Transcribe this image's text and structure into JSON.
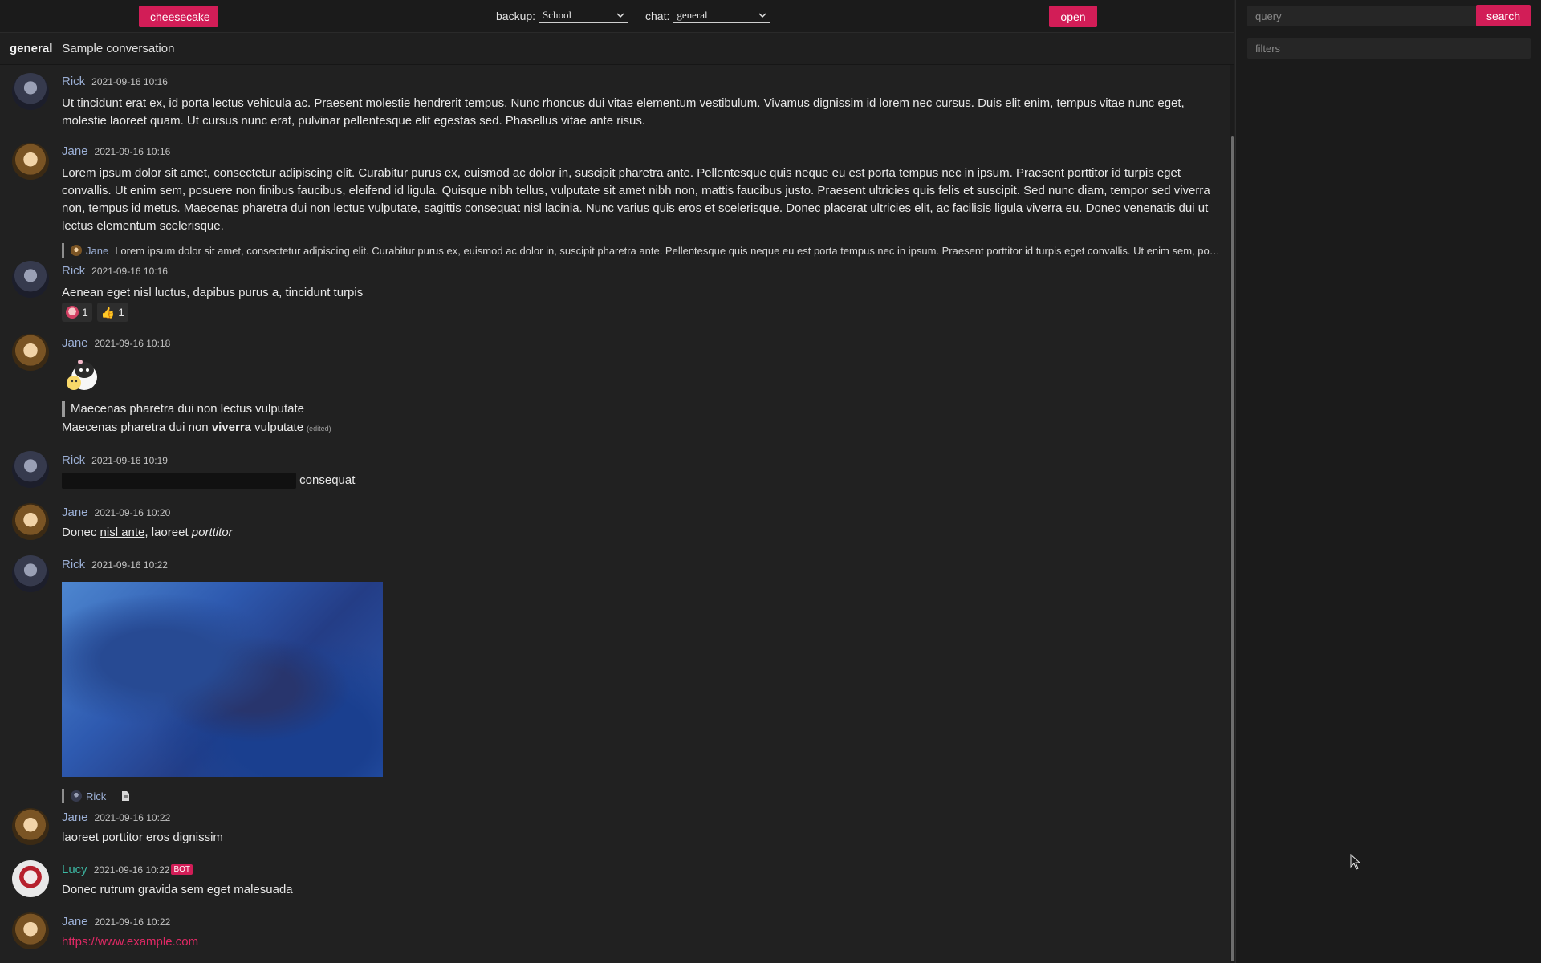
{
  "topbar": {
    "cheesecake_label": "cheesecake",
    "backup_label": "backup:",
    "backup_value": "School",
    "chat_label": "chat:",
    "chat_value": "general",
    "open_label": "open"
  },
  "header": {
    "chat_name": "general",
    "chat_description": "Sample conversation"
  },
  "search": {
    "query_placeholder": "query",
    "search_label": "search",
    "filters_placeholder": "filters"
  },
  "messages": [
    {
      "author": "Rick",
      "time": "2021-09-16 10:16",
      "text": "Ut tincidunt erat ex, id porta lectus vehicula ac. Praesent molestie hendrerit tempus. Nunc rhoncus dui vitae elementum vestibulum. Vivamus dignissim id lorem nec cursus. Duis elit enim, tempus vitae nunc eget, molestie laoreet quam. Ut cursus nunc erat, pulvinar pellentesque elit egestas sed. Phasellus vitae ante risus."
    },
    {
      "author": "Jane",
      "time": "2021-09-16 10:16",
      "text": "Lorem ipsum dolor sit amet, consectetur adipiscing elit. Curabitur purus ex, euismod ac dolor in, suscipit pharetra ante. Pellentesque quis neque eu est porta tempus nec in ipsum. Praesent porttitor id turpis eget convallis. Ut enim sem, posuere non finibus faucibus, eleifend id ligula. Quisque nibh tellus, vulputate sit amet nibh non, mattis faucibus justo. Praesent ultricies quis felis et suscipit. Sed nunc diam, tempor sed viverra non, tempus id metus. Maecenas pharetra dui non lectus vulputate, sagittis consequat nisl lacinia. Nunc varius quis eros et scelerisque. Donec placerat ultricies elit, ac facilisis ligula viverra eu. Donec venenatis dui ut lectus elementum scelerisque."
    },
    {
      "reply_author": "Jane",
      "reply_text": "Lorem ipsum dolor sit amet, consectetur adipiscing elit. Curabitur purus ex, euismod ac dolor in, suscipit pharetra ante. Pellentesque quis neque eu est porta tempus nec in ipsum. Praesent porttitor id turpis eget convallis. Ut enim sem, posuere non finibus faucibus, eleifend id ligula.",
      "author": "Rick",
      "time": "2021-09-16 10:16",
      "text": "Aenean eget nisl luctus, dapibus purus a, tincidunt turpis",
      "reactions": [
        {
          "emoji": "anime-girl",
          "count": "1"
        },
        {
          "emoji": "👍",
          "count": "1"
        }
      ]
    },
    {
      "author": "Jane",
      "time": "2021-09-16 10:18",
      "sticker": "penguin-chick-sticker",
      "quote": "Maecenas pharetra dui non lectus vulputate",
      "text_before": "Maecenas pharetra dui non ",
      "text_bold": "viverra",
      "text_after": " vulputate",
      "edited": "(edited)"
    },
    {
      "author": "Rick",
      "time": "2021-09-16 10:19",
      "text": "consequat"
    },
    {
      "author": "Jane",
      "time": "2021-09-16 10:20",
      "text_before": "Donec ",
      "text_underline": "nisl ante",
      "text_middle": ", laoreet ",
      "text_italic": "porttitor"
    },
    {
      "author": "Rick",
      "time": "2021-09-16 10:22"
    },
    {
      "reply_author": "Rick",
      "author": "Jane",
      "time": "2021-09-16 10:22",
      "text": "laoreet porttitor eros dignissim"
    },
    {
      "author": "Lucy",
      "time": "2021-09-16 10:22",
      "badge": "BOT",
      "text": "Donec rutrum gravida sem eget malesuada"
    },
    {
      "author": "Jane",
      "time": "2021-09-16 10:22",
      "link": "https://www.example.com"
    }
  ],
  "colors": {
    "accent": "#d21d57",
    "author": "#9cb0d6",
    "bot_author": "#3db9a4",
    "background": "#212121"
  }
}
